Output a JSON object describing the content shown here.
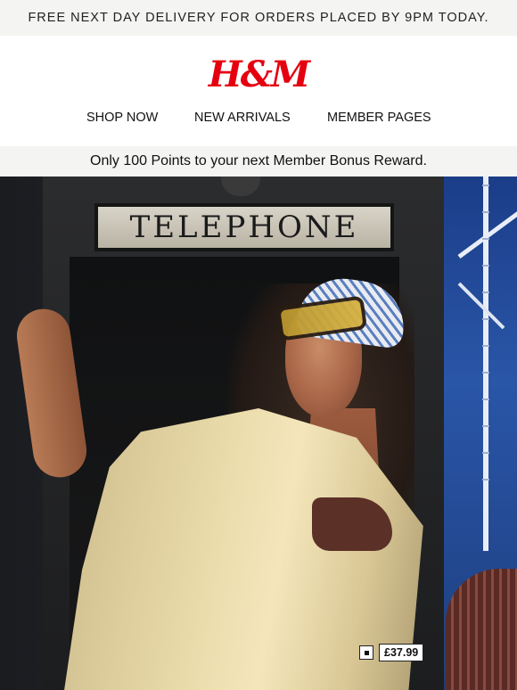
{
  "promo": {
    "text": "FREE NEXT DAY DELIVERY FOR ORDERS PLACED BY 9PM TODAY."
  },
  "header": {
    "logo": "H&M",
    "brand_color": "#e50010",
    "nav": [
      {
        "label": "SHOP NOW"
      },
      {
        "label": "NEW ARRIVALS"
      },
      {
        "label": "MEMBER PAGES"
      }
    ]
  },
  "bonus": {
    "text": "Only 100 Points to your next Member Bonus Reward."
  },
  "hero": {
    "sign_text": "TELEPHONE",
    "price": "£37.99",
    "price_icon": "product-tag-icon"
  }
}
